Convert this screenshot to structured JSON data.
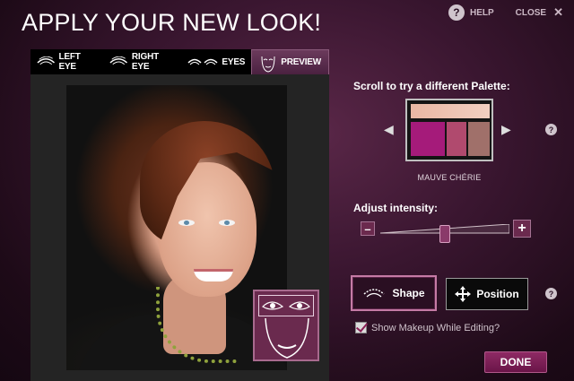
{
  "header": {
    "title": "APPLY YOUR NEW LOOK!",
    "help_icon": "?",
    "help_label": "HELP",
    "close_label": "CLOSE",
    "close_icon": "✕"
  },
  "tabs": [
    {
      "label": "LEFT EYE",
      "icon": "eye-icon"
    },
    {
      "label": "RIGHT EYE",
      "icon": "eye-icon"
    },
    {
      "label": "EYES",
      "icon": "eyes-icon"
    },
    {
      "label": "PREVIEW",
      "icon": "face-icon",
      "active": true
    }
  ],
  "palette": {
    "label": "Scroll to try a different Palette:",
    "prev_arrow": "◀",
    "next_arrow": "▶",
    "name": "MAUVE CHÉRIE",
    "help_icon": "?",
    "swatch_colors": [
      "#eebfad",
      "#a51b7a",
      "#b04a6e",
      "#a0706a"
    ]
  },
  "intensity": {
    "label": "Adjust intensity:",
    "minus": "–",
    "plus": "+",
    "value_fraction": 0.5
  },
  "tools": {
    "shape_label": "Shape",
    "position_label": "Position",
    "help_icon": "?"
  },
  "show_makeup": {
    "label": "Show Makeup While Editing?",
    "checked": true
  },
  "done_label": "DONE",
  "colors": {
    "accent": "#8e2a64",
    "background": "#3a1630"
  }
}
